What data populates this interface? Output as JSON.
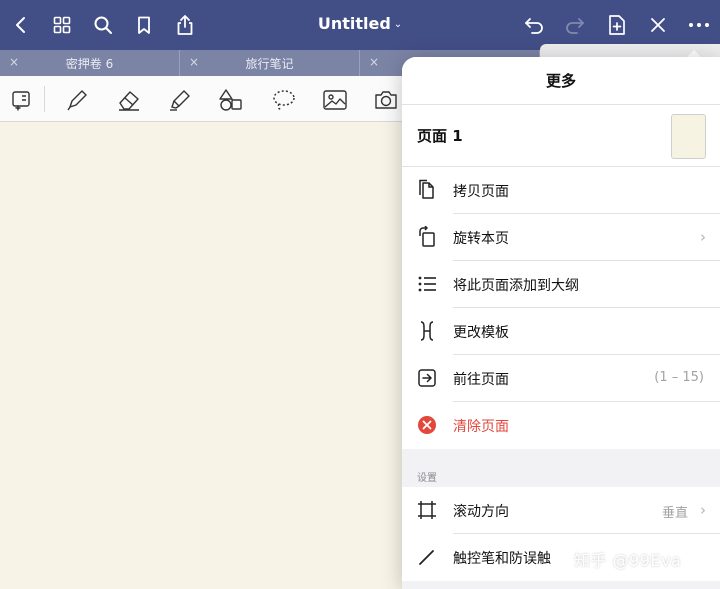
{
  "nav": {
    "title": "Untitled",
    "title_caret": "⌄",
    "left_icons": [
      "back-icon",
      "grid-icon",
      "search-icon",
      "bookmark-icon",
      "share-icon"
    ],
    "right_icons": [
      "undo-icon",
      "redo-icon",
      "add-page-icon",
      "close-tab-icon",
      "more-icon"
    ]
  },
  "tabs": [
    {
      "label": "密押卷 6",
      "close": "×"
    },
    {
      "label": "旅行笔记",
      "close": "×"
    },
    {
      "label": "",
      "close": "×"
    },
    {
      "label": "",
      "close": ""
    }
  ],
  "toolbar": {
    "icons": [
      "lasso-shape-icon",
      "pen-icon",
      "eraser-icon",
      "highlighter-icon",
      "shapes-icon",
      "lasso-icon",
      "image-icon",
      "camera-icon"
    ]
  },
  "popover": {
    "title": "更多",
    "page_label": "页面 1",
    "items": [
      {
        "label": "拷贝页面",
        "icon": "copy-page-icon",
        "value": "",
        "chevron": false,
        "danger": false
      },
      {
        "label": "旋转本页",
        "icon": "rotate-page-icon",
        "value": "",
        "chevron": true,
        "danger": false
      },
      {
        "label": "将此页面添加到大纲",
        "icon": "outline-icon",
        "value": "",
        "chevron": false,
        "danger": false
      },
      {
        "label": "更改模板",
        "icon": "template-icon",
        "value": "",
        "chevron": false,
        "danger": false
      },
      {
        "label": "前往页面",
        "icon": "go-to-page-icon",
        "value": "(1 – 15)",
        "chevron": false,
        "danger": false
      },
      {
        "label": "清除页面",
        "icon": "clear-page-icon",
        "value": "",
        "chevron": false,
        "danger": true
      }
    ],
    "settings_label": "设置",
    "settings": [
      {
        "label": "滚动方向",
        "icon": "scroll-direction-icon",
        "value": "垂直",
        "chevron": true
      },
      {
        "label": "触控笔和防误触",
        "icon": "stylus-icon",
        "value": "",
        "chevron": false
      }
    ]
  },
  "watermark": "知乎 @99Eva",
  "colors": {
    "navbar": "#424e86",
    "tabstrip": "#7c84a6",
    "canvas": "#f7f3e6",
    "danger": "#e2483c"
  }
}
